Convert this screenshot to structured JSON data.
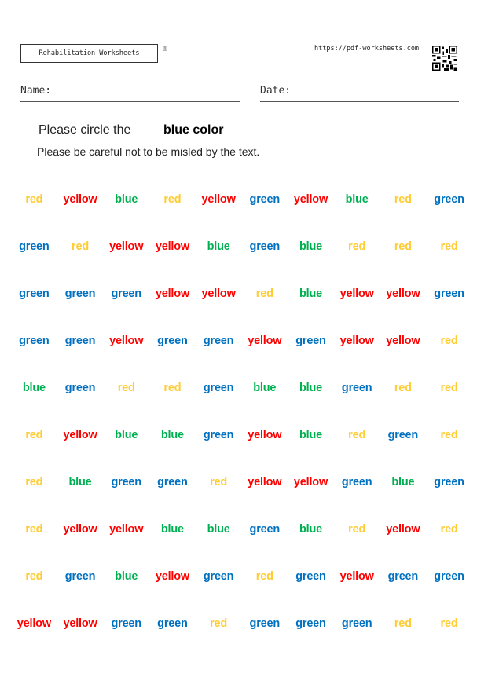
{
  "header": {
    "brand": "Rehabilitation Worksheets",
    "registered_mark": "®",
    "url": "https://pdf-worksheets.com",
    "qr_icon": "qr-code-icon"
  },
  "fields": {
    "name_label": "Name:",
    "date_label": "Date:"
  },
  "instructions": {
    "line1": "Please circle the",
    "target": "blue color",
    "line2": "Please be careful not to be misled by the text."
  },
  "colors": {
    "red": "#FF0000",
    "yellow": "#FFCC33",
    "green": "#00B050",
    "blue": "#0070C0"
  },
  "grid": [
    [
      [
        "red",
        "yellow"
      ],
      [
        "yellow",
        "red"
      ],
      [
        "blue",
        "green"
      ],
      [
        "red",
        "yellow"
      ],
      [
        "yellow",
        "red"
      ],
      [
        "green",
        "blue"
      ],
      [
        "yellow",
        "red"
      ],
      [
        "blue",
        "green"
      ],
      [
        "red",
        "yellow"
      ],
      [
        "green",
        "blue"
      ]
    ],
    [
      [
        "green",
        "blue"
      ],
      [
        "red",
        "yellow"
      ],
      [
        "yellow",
        "red"
      ],
      [
        "yellow",
        "red"
      ],
      [
        "blue",
        "green"
      ],
      [
        "green",
        "blue"
      ],
      [
        "blue",
        "green"
      ],
      [
        "red",
        "yellow"
      ],
      [
        "red",
        "yellow"
      ],
      [
        "red",
        "yellow"
      ]
    ],
    [
      [
        "green",
        "blue"
      ],
      [
        "green",
        "blue"
      ],
      [
        "green",
        "blue"
      ],
      [
        "yellow",
        "red"
      ],
      [
        "yellow",
        "red"
      ],
      [
        "red",
        "yellow"
      ],
      [
        "blue",
        "green"
      ],
      [
        "yellow",
        "red"
      ],
      [
        "yellow",
        "red"
      ],
      [
        "green",
        "blue"
      ]
    ],
    [
      [
        "green",
        "blue"
      ],
      [
        "green",
        "blue"
      ],
      [
        "yellow",
        "red"
      ],
      [
        "green",
        "blue"
      ],
      [
        "green",
        "blue"
      ],
      [
        "yellow",
        "red"
      ],
      [
        "green",
        "blue"
      ],
      [
        "yellow",
        "red"
      ],
      [
        "yellow",
        "red"
      ],
      [
        "red",
        "yellow"
      ]
    ],
    [
      [
        "blue",
        "green"
      ],
      [
        "green",
        "blue"
      ],
      [
        "red",
        "yellow"
      ],
      [
        "red",
        "yellow"
      ],
      [
        "green",
        "blue"
      ],
      [
        "blue",
        "green"
      ],
      [
        "blue",
        "green"
      ],
      [
        "green",
        "blue"
      ],
      [
        "red",
        "yellow"
      ],
      [
        "red",
        "yellow"
      ]
    ],
    [
      [
        "red",
        "yellow"
      ],
      [
        "yellow",
        "red"
      ],
      [
        "blue",
        "green"
      ],
      [
        "blue",
        "green"
      ],
      [
        "green",
        "blue"
      ],
      [
        "yellow",
        "red"
      ],
      [
        "blue",
        "green"
      ],
      [
        "red",
        "yellow"
      ],
      [
        "green",
        "blue"
      ],
      [
        "red",
        "yellow"
      ]
    ],
    [
      [
        "red",
        "yellow"
      ],
      [
        "blue",
        "green"
      ],
      [
        "green",
        "blue"
      ],
      [
        "green",
        "blue"
      ],
      [
        "red",
        "yellow"
      ],
      [
        "yellow",
        "red"
      ],
      [
        "yellow",
        "red"
      ],
      [
        "green",
        "blue"
      ],
      [
        "blue",
        "green"
      ],
      [
        "green",
        "blue"
      ]
    ],
    [
      [
        "red",
        "yellow"
      ],
      [
        "yellow",
        "red"
      ],
      [
        "yellow",
        "red"
      ],
      [
        "blue",
        "green"
      ],
      [
        "blue",
        "green"
      ],
      [
        "green",
        "blue"
      ],
      [
        "blue",
        "green"
      ],
      [
        "red",
        "yellow"
      ],
      [
        "yellow",
        "red"
      ],
      [
        "red",
        "yellow"
      ]
    ],
    [
      [
        "red",
        "yellow"
      ],
      [
        "green",
        "blue"
      ],
      [
        "blue",
        "green"
      ],
      [
        "yellow",
        "red"
      ],
      [
        "green",
        "blue"
      ],
      [
        "red",
        "yellow"
      ],
      [
        "green",
        "blue"
      ],
      [
        "yellow",
        "red"
      ],
      [
        "green",
        "blue"
      ],
      [
        "green",
        "blue"
      ]
    ],
    [
      [
        "yellow",
        "red"
      ],
      [
        "yellow",
        "red"
      ],
      [
        "green",
        "blue"
      ],
      [
        "green",
        "blue"
      ],
      [
        "red",
        "yellow"
      ],
      [
        "green",
        "blue"
      ],
      [
        "green",
        "blue"
      ],
      [
        "green",
        "blue"
      ],
      [
        "red",
        "yellow"
      ],
      [
        "red",
        "yellow"
      ]
    ]
  ]
}
